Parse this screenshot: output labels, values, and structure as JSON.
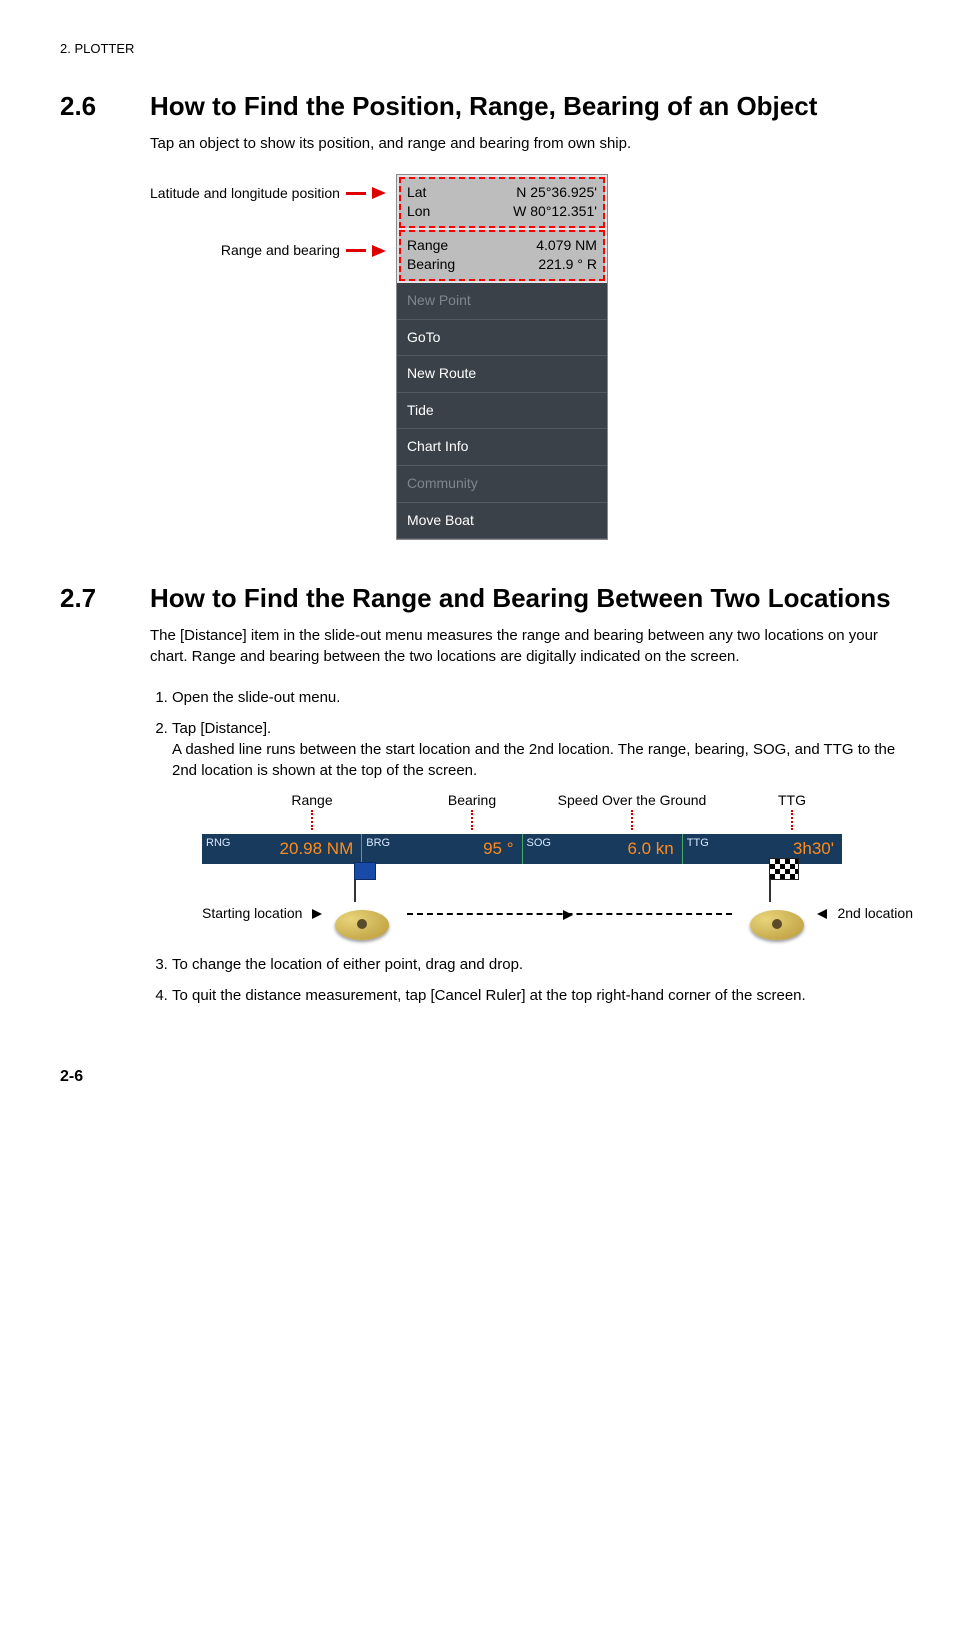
{
  "header": "2.  PLOTTER",
  "section26": {
    "num": "2.6",
    "title": "How to Find the Position, Range, Bearing of an Object",
    "intro": "Tap an object to show its position, and range and bearing from own ship.",
    "callout_latlon": "Latitude and longitude position",
    "callout_rb": "Range and bearing",
    "popup": {
      "lat_lbl": "Lat",
      "lat_val": "N 25°36.925'",
      "lon_lbl": "Lon",
      "lon_val": "W 80°12.351'",
      "range_lbl": "Range",
      "range_val": "4.079 NM",
      "bearing_lbl": "Bearing",
      "bearing_val": "221.9 ° R",
      "items": [
        "New Point",
        "GoTo",
        "New Route",
        "Tide",
        "Chart Info",
        "Community",
        "Move Boat"
      ]
    }
  },
  "section27": {
    "num": "2.7",
    "title": "How to Find the Range and Bearing Between Two Locations",
    "intro": "The [Distance] item in the slide-out menu measures the range and bearing between any two locations on your chart. Range and bearing between the two locations are digitally indicated on the screen.",
    "step1": "Open the slide-out menu.",
    "step2a": "Tap [Distance].",
    "step2b": "A dashed line runs between the start location and the 2nd location. The range, bearing, SOG, and TTG to the 2nd location is shown at the top of the screen.",
    "labels": {
      "range": "Range",
      "bearing": "Bearing",
      "sog": "Speed Over the Ground",
      "ttg": "TTG"
    },
    "bar": {
      "rng_lbl": "RNG",
      "rng_val": "20.98 NM",
      "brg_lbl": "BRG",
      "brg_val": "95 °",
      "sog_lbl": "SOG",
      "sog_val": "6.0 kn",
      "ttg_lbl": "TTG",
      "ttg_val": "3h30'"
    },
    "start_label": "Starting location",
    "end_label": "2nd location",
    "step3": "To change the location of either point, drag and drop.",
    "step4": "To quit the distance measurement, tap [Cancel Ruler] at the top right-hand corner of the screen."
  },
  "page": "2-6"
}
